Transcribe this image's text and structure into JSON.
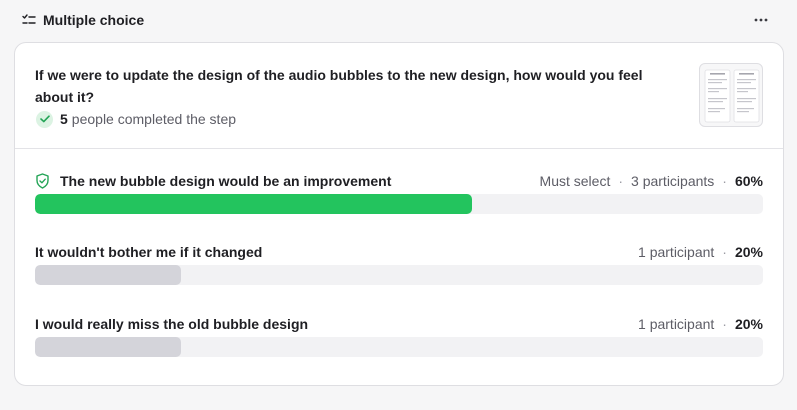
{
  "header": {
    "title": "Multiple choice",
    "type_icon": "checklist-icon",
    "more_icon": "more-horizontal-icon"
  },
  "question": {
    "text": "If we were to update the design of the audio bubbles to the new design, how would you feel about it?",
    "completed_count": "5",
    "completed_label": "people completed the step"
  },
  "options": [
    {
      "label": "The new bubble design would be an improvement",
      "must_select": "Must select",
      "participants": "3 participants",
      "percent": "60%",
      "fraction": 0.6,
      "bar_color": "#23c45e",
      "icon": "shield-check-icon"
    },
    {
      "label": "It wouldn't bother me if it changed",
      "participants": "1 participant",
      "percent": "20%",
      "fraction": 0.2,
      "bar_color": "#d4d4da"
    },
    {
      "label": "I would really miss the old bubble design",
      "participants": "1 participant",
      "percent": "20%",
      "fraction": 0.2,
      "bar_color": "#d4d4da"
    }
  ],
  "colors": {
    "accent_green": "#23c45e",
    "muted_bar": "#d4d4da",
    "track": "#f2f2f4"
  }
}
